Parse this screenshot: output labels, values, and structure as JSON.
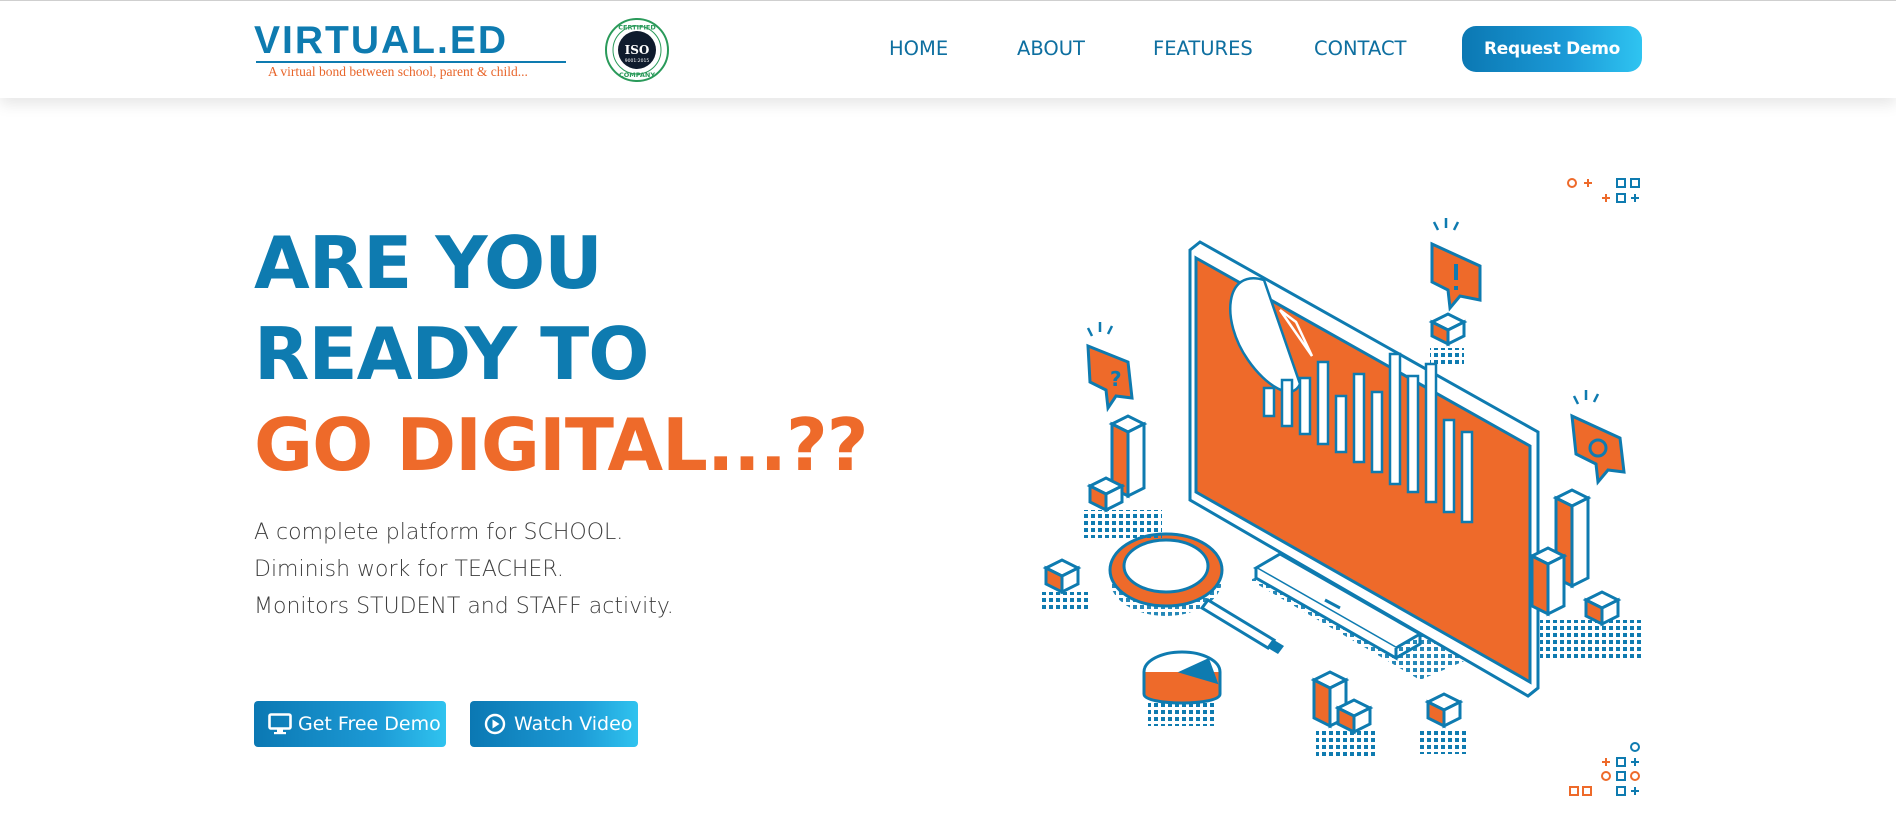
{
  "brand": {
    "name": "VIRTUAL.ED",
    "tagline": "A virtual bond between school, parent & child...",
    "badge_top": "CERTIFIED",
    "badge_center": "ISO",
    "badge_sub": "9001:2015",
    "badge_bottom": "COMPANY"
  },
  "nav": {
    "items": [
      {
        "label": "HOME"
      },
      {
        "label": "ABOUT"
      },
      {
        "label": "FEATURES"
      },
      {
        "label": "CONTACT"
      }
    ],
    "cta_label": "Request Demo"
  },
  "hero": {
    "title_line1": "ARE YOU",
    "title_line2": "READY TO",
    "title_line3": "GO DIGITAL...??",
    "desc_line1": "A complete platform for SCHOOL.",
    "desc_line2": "Diminish work for TEACHER.",
    "desc_line3": "Monitors STUDENT and STAFF activity.",
    "primary_button": "Get Free Demo",
    "secondary_button": "Watch Video"
  },
  "colors": {
    "brand_blue": "#0e7bb0",
    "brand_orange": "#ee6a2a",
    "cta_gradient_end": "#2fc4f1"
  },
  "icons": {
    "demo_button_icon": "monitor-icon",
    "video_button_icon": "play-circle-icon",
    "badge": "iso-certified-badge-icon"
  }
}
